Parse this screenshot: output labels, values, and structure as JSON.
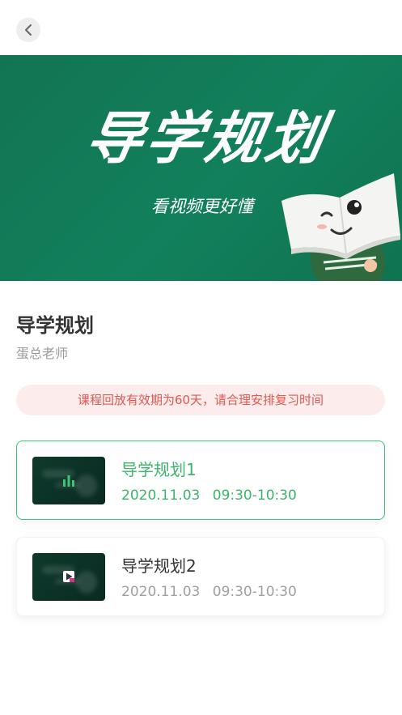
{
  "header": {
    "back_icon": "chevron-left-icon"
  },
  "banner": {
    "title": "导学规划",
    "subtitle": "看视频更好懂",
    "mascot_icon": "book-mascot-icon",
    "bg_color": "#12805c"
  },
  "course": {
    "title": "导学规划",
    "teacher": "蛋总老师"
  },
  "notice": {
    "text": "课程回放有效期为60天，请合理安排复习时间",
    "color": "#e0584f",
    "bg": "#fdecec"
  },
  "lessons": [
    {
      "name": "导学规划1",
      "date": "2020.11.03",
      "time": "09:30-10:30",
      "state": "playing",
      "icon": "equalizer-icon",
      "accent": "#3cb46e"
    },
    {
      "name": "导学规划2",
      "date": "2020.11.03",
      "time": "09:30-10:30",
      "state": "idle",
      "icon": "play-icon"
    }
  ]
}
